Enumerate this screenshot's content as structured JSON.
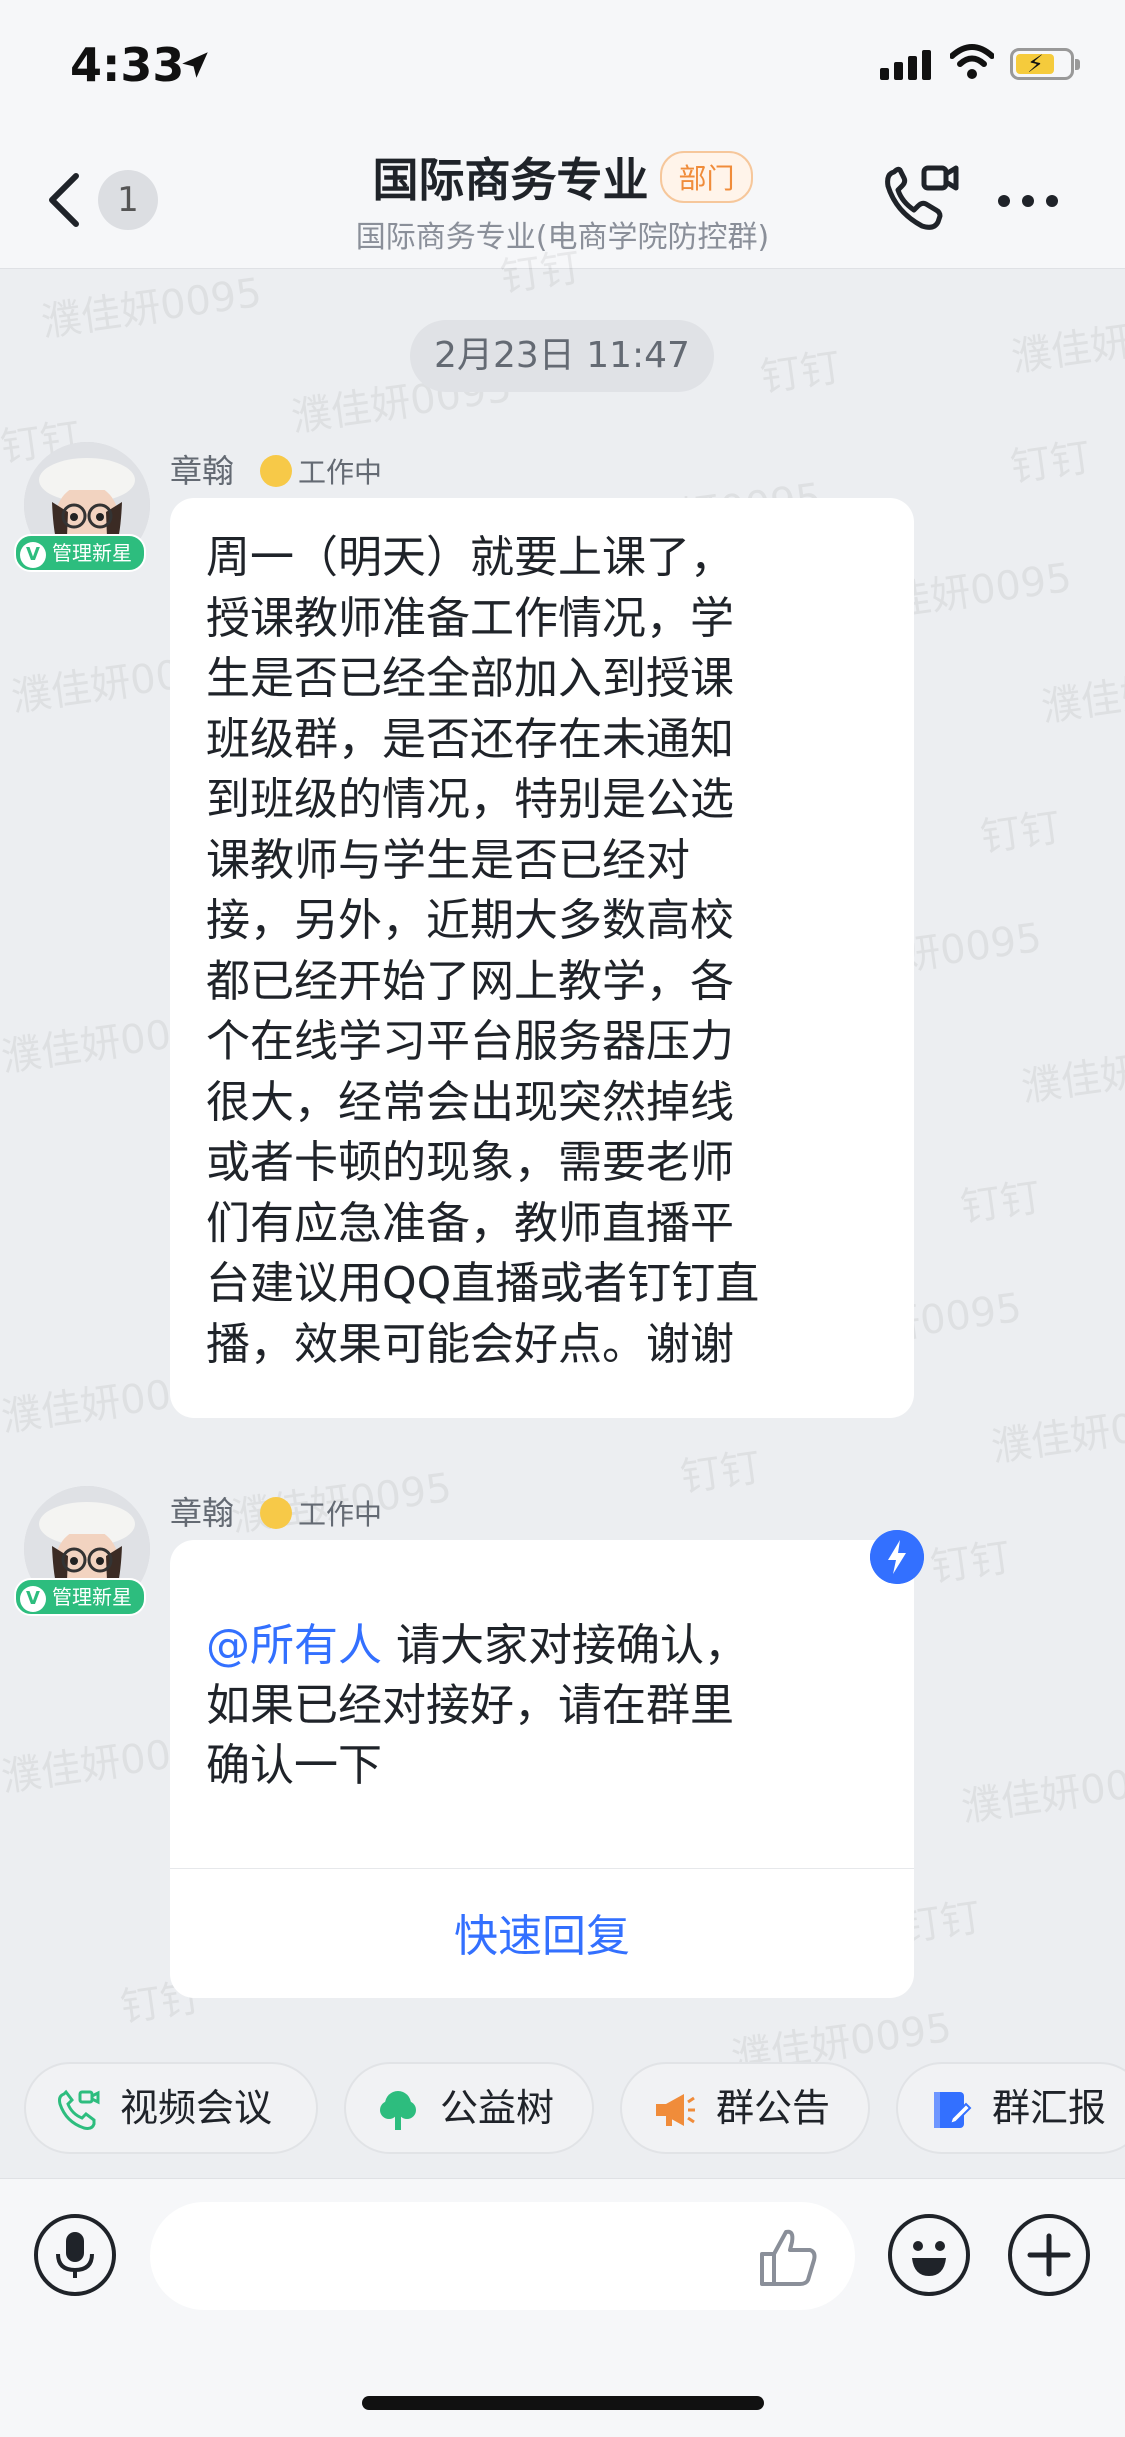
{
  "status_bar": {
    "time": "4:33"
  },
  "header": {
    "unread_count": "1",
    "title": "国际商务专业",
    "tag": "部门",
    "subtitle": "国际商务专业(电商学院防控群)"
  },
  "watermarks": [
    "濮佳妍0095",
    "钉钉"
  ],
  "timestamp": "2月23日 11:47",
  "messages": [
    {
      "sender": "章翰",
      "status": "工作中",
      "badge": "管理新星",
      "lines": [
        "周一（明天）就要上课了，",
        "授课教师准备工作情况，学",
        "生是否已经全部加入到授课",
        "班级群，是否还存在未通知",
        "到班级的情况，特别是公选",
        "课教师与学生是否已经对",
        "接，另外，近期大多数高校",
        "都已经开始了网上教学，各",
        "个在线学习平台服务器压力",
        "很大，经常会出现突然掉线",
        "或者卡顿的现象，需要老师",
        "们有应急准备，教师直播平",
        "台建议用QQ直播或者钉钉直",
        "播，效果可能会好点。谢谢"
      ]
    },
    {
      "sender": "章翰",
      "status": "工作中",
      "badge": "管理新星",
      "mention": "@所有人",
      "line1_rest": " 请大家对接确认，",
      "line2": "如果已经对接好，请在群里",
      "line3": "确认一下",
      "quick_reply": "快速回复"
    }
  ],
  "tools": [
    {
      "label": "视频会议",
      "icon": "video-call-icon",
      "color": "#2dbd7e"
    },
    {
      "label": "公益树",
      "icon": "tree-icon",
      "color": "#2dbd7e"
    },
    {
      "label": "群公告",
      "icon": "megaphone-icon",
      "color": "#f08c3a"
    },
    {
      "label": "群汇报",
      "icon": "report-icon",
      "color": "#3370ff"
    }
  ],
  "colors": {
    "accent": "#3370ff",
    "green": "#2dbd7e",
    "orange": "#f08c3a"
  }
}
